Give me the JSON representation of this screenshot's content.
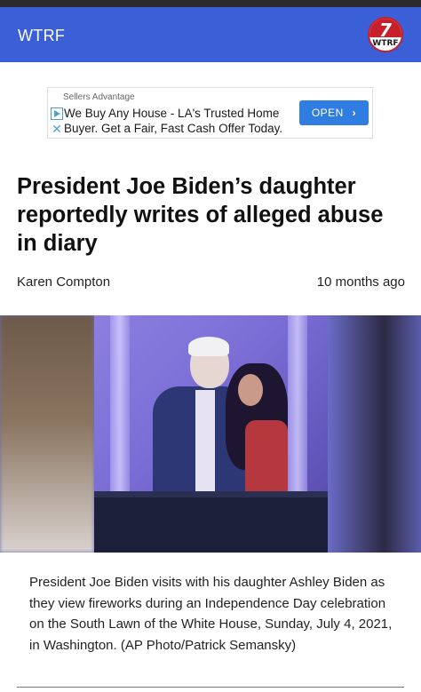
{
  "header": {
    "site_name": "WTRF",
    "logo_numeral": "7",
    "logo_text": "WTRF"
  },
  "ad": {
    "advertiser": "Sellers Advantage",
    "text": "We Buy Any House - LA's Trusted Home Buyer. Get a Fair, Fast Cash Offer Today.",
    "button_label": "OPEN",
    "button_chevron": "›",
    "ad_icon": "ad-choices-icon",
    "close_icon_glyph": "✕"
  },
  "article": {
    "headline": "President Joe Biden’s daughter reportedly writes of alleged abuse in diary",
    "author": "Karen Compton",
    "timestamp": "10 months ago",
    "caption": "President Joe Biden visits with his daughter Ashley Biden as they view fireworks during an Independence Day celebration on the South Lawn of the White House, Sunday, July 4, 2021, in Washington. (AP Photo/Patrick Semansky)"
  },
  "colors": {
    "header_bg": "#3b5fd6",
    "ad_button": "#2f7de1",
    "logo_red": "#c8202a"
  }
}
